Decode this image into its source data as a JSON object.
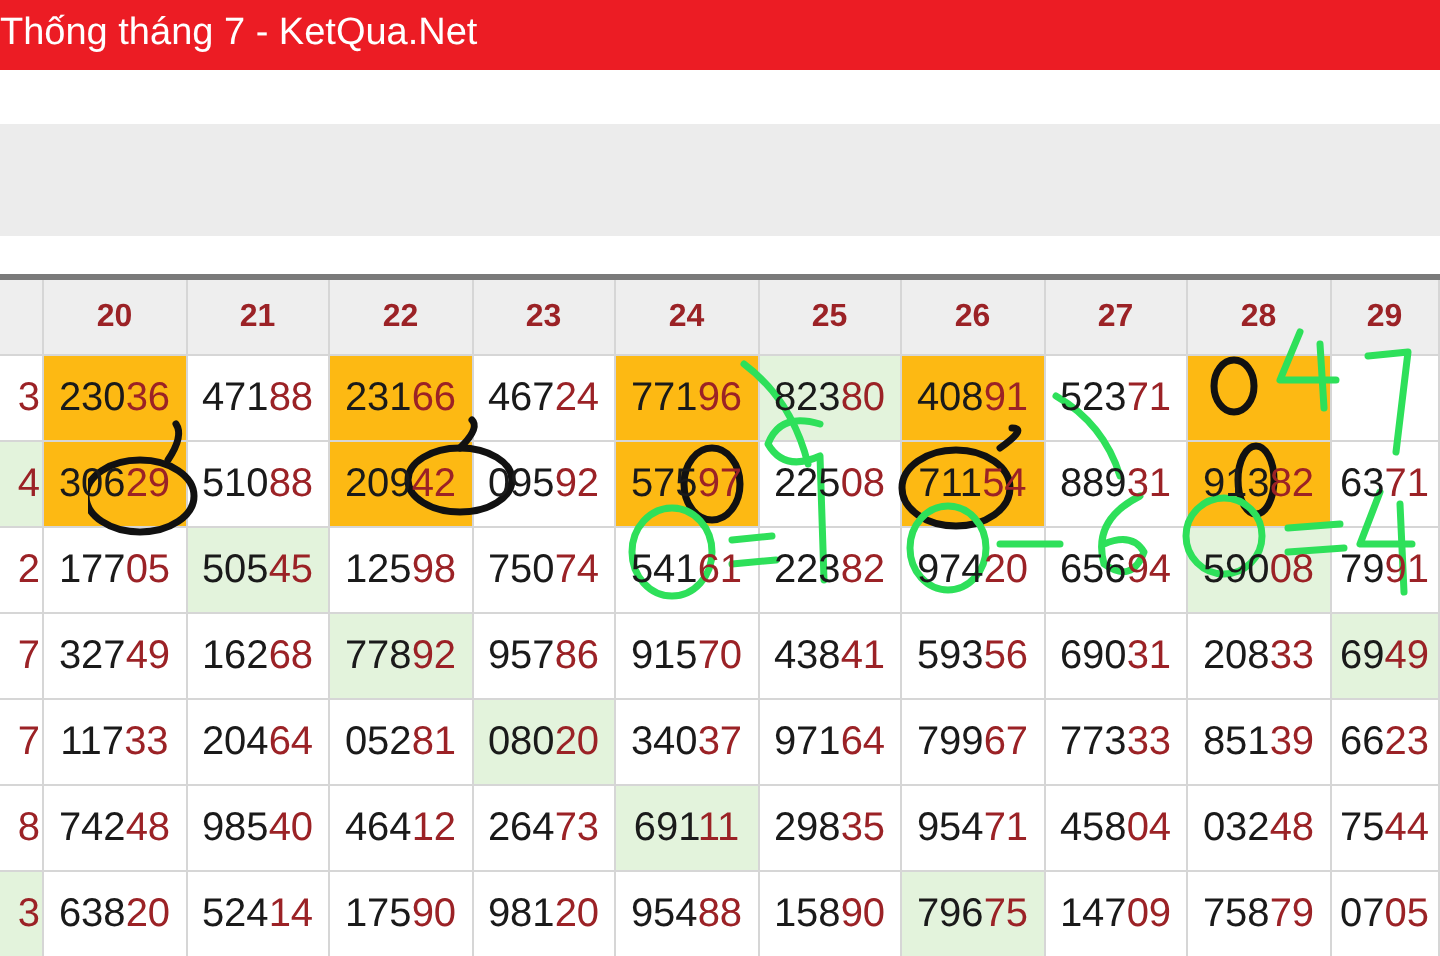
{
  "header": {
    "title": "Thống tháng 7 - KetQua.Net"
  },
  "table": {
    "columns": [
      "",
      "20",
      "21",
      "22",
      "23",
      "24",
      "25",
      "26",
      "27",
      "28",
      "29"
    ],
    "rows": [
      {
        "cells": [
          {
            "text": "3"
          },
          {
            "text": "23036",
            "color": "#fdb913"
          },
          {
            "text": "47188"
          },
          {
            "text": "23166",
            "color": "#fdb913"
          },
          {
            "text": "46724"
          },
          {
            "text": "77196",
            "color": "#fdb913"
          },
          {
            "text": "82380",
            "color": "#e3f3dc"
          },
          {
            "text": "40891",
            "color": "#fdb913"
          },
          {
            "text": "52371"
          },
          {
            "color": "#fdb913"
          },
          {}
        ]
      },
      {
        "cells": [
          {
            "text": "4",
            "color": "#e3f3dc"
          },
          {
            "text": "30629",
            "color": "#fdb913"
          },
          {
            "text": "51088"
          },
          {
            "text": "20942",
            "color": "#fdb913"
          },
          {
            "text": "09592"
          },
          {
            "text": "57597",
            "color": "#fdb913"
          },
          {
            "text": "22508"
          },
          {
            "text": "71154",
            "color": "#fdb913"
          },
          {
            "text": "88931"
          },
          {
            "text": "91382",
            "color": "#fdb913"
          },
          {
            "text": "6371"
          }
        ]
      },
      {
        "cells": [
          {
            "text": "2"
          },
          {
            "text": "17705"
          },
          {
            "text": "50545",
            "color": "#e3f3dc"
          },
          {
            "text": "12598"
          },
          {
            "text": "75074"
          },
          {
            "text": "54161"
          },
          {
            "text": "22382"
          },
          {
            "text": "97420"
          },
          {
            "text": "65694"
          },
          {
            "text": "59008",
            "color": "#e3f3dc"
          },
          {
            "text": "7991"
          }
        ]
      },
      {
        "cells": [
          {
            "text": "7"
          },
          {
            "text": "32749"
          },
          {
            "text": "16268"
          },
          {
            "text": "77892",
            "color": "#e3f3dc"
          },
          {
            "text": "95786"
          },
          {
            "text": "91570"
          },
          {
            "text": "43841"
          },
          {
            "text": "59356"
          },
          {
            "text": "69031"
          },
          {
            "text": "20833"
          },
          {
            "text": "6949",
            "color": "#e3f3dc"
          }
        ]
      },
      {
        "cells": [
          {
            "text": "7"
          },
          {
            "text": "11733"
          },
          {
            "text": "20464"
          },
          {
            "text": "05281"
          },
          {
            "text": "08020",
            "color": "#e3f3dc"
          },
          {
            "text": "34037"
          },
          {
            "text": "97164"
          },
          {
            "text": "79967"
          },
          {
            "text": "77333"
          },
          {
            "text": "85139"
          },
          {
            "text": "6623"
          }
        ]
      },
      {
        "cells": [
          {
            "text": "8"
          },
          {
            "text": "74248"
          },
          {
            "text": "98540"
          },
          {
            "text": "46412"
          },
          {
            "text": "26473"
          },
          {
            "text": "69111",
            "color": "#e3f3dc"
          },
          {
            "text": "29835"
          },
          {
            "text": "95471"
          },
          {
            "text": "45804"
          },
          {
            "text": "03248"
          },
          {
            "text": "7544"
          }
        ]
      },
      {
        "cells": [
          {
            "text": "3",
            "color": "#e3f3dc"
          },
          {
            "text": "63820"
          },
          {
            "text": "52414"
          },
          {
            "text": "17590"
          },
          {
            "text": "98120"
          },
          {
            "text": "95488"
          },
          {
            "text": "15890"
          },
          {
            "text": "79675",
            "color": "#e3f3dc"
          },
          {
            "text": "14709"
          },
          {
            "text": "75879"
          },
          {
            "text": "0705"
          }
        ]
      }
    ]
  }
}
